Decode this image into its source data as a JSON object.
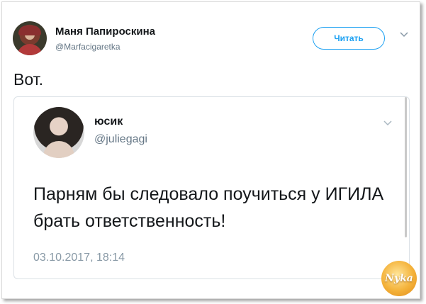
{
  "author": {
    "name": "Маня Папироскина",
    "handle": "@Marfacigaretka"
  },
  "follow_button_label": "Читать",
  "tweet_text": "Вот.",
  "quoted_tweet": {
    "name": "юсик",
    "handle": "@juliegagi",
    "text": "Парням бы следовало поучиться у ИГИЛА брать ответственность!",
    "date": "03.10.2017, 18:14"
  },
  "watermark_text": "Nyka",
  "icons": [
    "chevron-down-icon"
  ],
  "colors": {
    "accent": "#1da1f2",
    "text": "#14171a",
    "muted": "#657786"
  }
}
